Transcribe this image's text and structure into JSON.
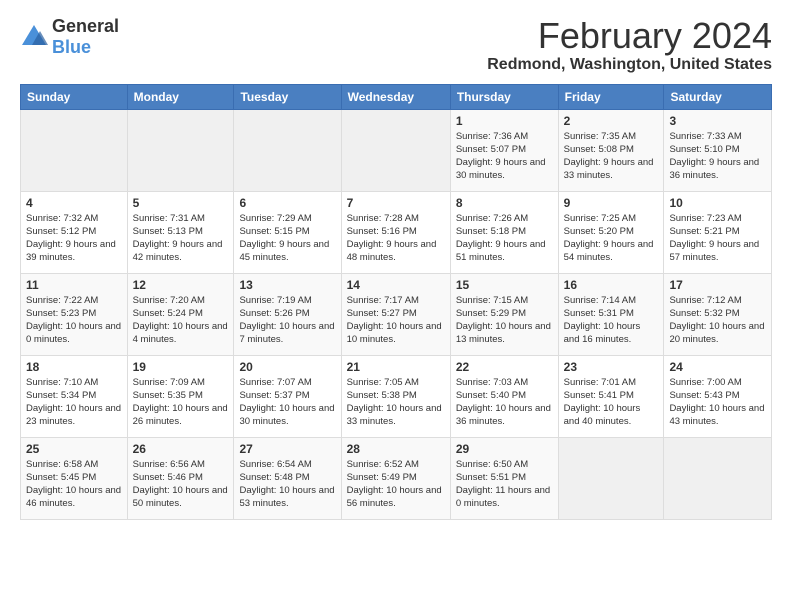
{
  "logo": {
    "general": "General",
    "blue": "Blue"
  },
  "title": "February 2024",
  "subtitle": "Redmond, Washington, United States",
  "days_of_week": [
    "Sunday",
    "Monday",
    "Tuesday",
    "Wednesday",
    "Thursday",
    "Friday",
    "Saturday"
  ],
  "weeks": [
    [
      {
        "day": "",
        "info": ""
      },
      {
        "day": "",
        "info": ""
      },
      {
        "day": "",
        "info": ""
      },
      {
        "day": "",
        "info": ""
      },
      {
        "day": "1",
        "info": "Sunrise: 7:36 AM\nSunset: 5:07 PM\nDaylight: 9 hours and 30 minutes."
      },
      {
        "day": "2",
        "info": "Sunrise: 7:35 AM\nSunset: 5:08 PM\nDaylight: 9 hours and 33 minutes."
      },
      {
        "day": "3",
        "info": "Sunrise: 7:33 AM\nSunset: 5:10 PM\nDaylight: 9 hours and 36 minutes."
      }
    ],
    [
      {
        "day": "4",
        "info": "Sunrise: 7:32 AM\nSunset: 5:12 PM\nDaylight: 9 hours and 39 minutes."
      },
      {
        "day": "5",
        "info": "Sunrise: 7:31 AM\nSunset: 5:13 PM\nDaylight: 9 hours and 42 minutes."
      },
      {
        "day": "6",
        "info": "Sunrise: 7:29 AM\nSunset: 5:15 PM\nDaylight: 9 hours and 45 minutes."
      },
      {
        "day": "7",
        "info": "Sunrise: 7:28 AM\nSunset: 5:16 PM\nDaylight: 9 hours and 48 minutes."
      },
      {
        "day": "8",
        "info": "Sunrise: 7:26 AM\nSunset: 5:18 PM\nDaylight: 9 hours and 51 minutes."
      },
      {
        "day": "9",
        "info": "Sunrise: 7:25 AM\nSunset: 5:20 PM\nDaylight: 9 hours and 54 minutes."
      },
      {
        "day": "10",
        "info": "Sunrise: 7:23 AM\nSunset: 5:21 PM\nDaylight: 9 hours and 57 minutes."
      }
    ],
    [
      {
        "day": "11",
        "info": "Sunrise: 7:22 AM\nSunset: 5:23 PM\nDaylight: 10 hours and 0 minutes."
      },
      {
        "day": "12",
        "info": "Sunrise: 7:20 AM\nSunset: 5:24 PM\nDaylight: 10 hours and 4 minutes."
      },
      {
        "day": "13",
        "info": "Sunrise: 7:19 AM\nSunset: 5:26 PM\nDaylight: 10 hours and 7 minutes."
      },
      {
        "day": "14",
        "info": "Sunrise: 7:17 AM\nSunset: 5:27 PM\nDaylight: 10 hours and 10 minutes."
      },
      {
        "day": "15",
        "info": "Sunrise: 7:15 AM\nSunset: 5:29 PM\nDaylight: 10 hours and 13 minutes."
      },
      {
        "day": "16",
        "info": "Sunrise: 7:14 AM\nSunset: 5:31 PM\nDaylight: 10 hours and 16 minutes."
      },
      {
        "day": "17",
        "info": "Sunrise: 7:12 AM\nSunset: 5:32 PM\nDaylight: 10 hours and 20 minutes."
      }
    ],
    [
      {
        "day": "18",
        "info": "Sunrise: 7:10 AM\nSunset: 5:34 PM\nDaylight: 10 hours and 23 minutes."
      },
      {
        "day": "19",
        "info": "Sunrise: 7:09 AM\nSunset: 5:35 PM\nDaylight: 10 hours and 26 minutes."
      },
      {
        "day": "20",
        "info": "Sunrise: 7:07 AM\nSunset: 5:37 PM\nDaylight: 10 hours and 30 minutes."
      },
      {
        "day": "21",
        "info": "Sunrise: 7:05 AM\nSunset: 5:38 PM\nDaylight: 10 hours and 33 minutes."
      },
      {
        "day": "22",
        "info": "Sunrise: 7:03 AM\nSunset: 5:40 PM\nDaylight: 10 hours and 36 minutes."
      },
      {
        "day": "23",
        "info": "Sunrise: 7:01 AM\nSunset: 5:41 PM\nDaylight: 10 hours and 40 minutes."
      },
      {
        "day": "24",
        "info": "Sunrise: 7:00 AM\nSunset: 5:43 PM\nDaylight: 10 hours and 43 minutes."
      }
    ],
    [
      {
        "day": "25",
        "info": "Sunrise: 6:58 AM\nSunset: 5:45 PM\nDaylight: 10 hours and 46 minutes."
      },
      {
        "day": "26",
        "info": "Sunrise: 6:56 AM\nSunset: 5:46 PM\nDaylight: 10 hours and 50 minutes."
      },
      {
        "day": "27",
        "info": "Sunrise: 6:54 AM\nSunset: 5:48 PM\nDaylight: 10 hours and 53 minutes."
      },
      {
        "day": "28",
        "info": "Sunrise: 6:52 AM\nSunset: 5:49 PM\nDaylight: 10 hours and 56 minutes."
      },
      {
        "day": "29",
        "info": "Sunrise: 6:50 AM\nSunset: 5:51 PM\nDaylight: 11 hours and 0 minutes."
      },
      {
        "day": "",
        "info": ""
      },
      {
        "day": "",
        "info": ""
      }
    ]
  ]
}
